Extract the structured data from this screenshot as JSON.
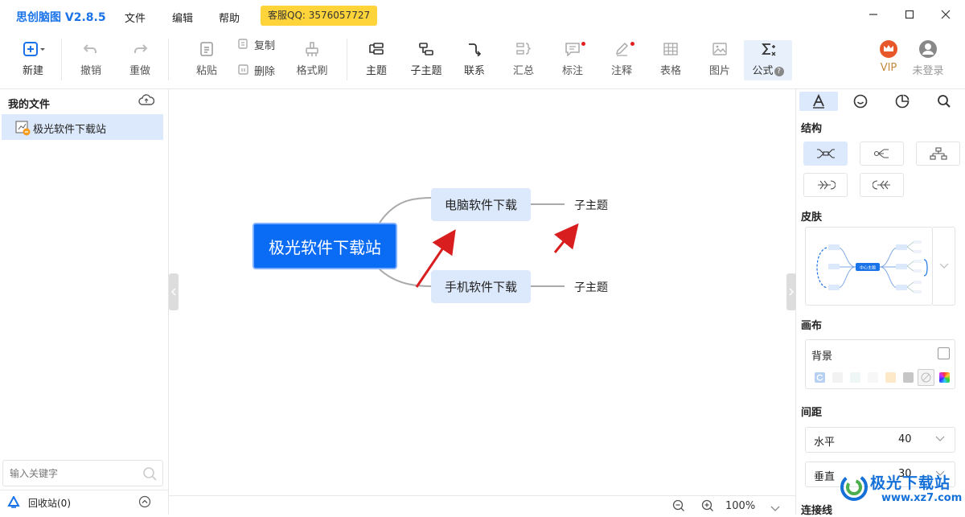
{
  "titlebar": {
    "app_title": "思创脑图 V2.8.5",
    "menus": [
      "文件",
      "编辑",
      "帮助"
    ],
    "qq_badge": "客服QQ: 3576057727"
  },
  "toolbar": {
    "new_label": "新建",
    "undo_label": "撤销",
    "redo_label": "重做",
    "paste_label": "粘贴",
    "copy_label": "复制",
    "delete_label": "删除",
    "format_brush_label": "格式刷",
    "topic_label": "主题",
    "subtopic_label": "子主题",
    "relation_label": "联系",
    "summary_label": "汇总",
    "marker_label": "标注",
    "note_label": "注释",
    "table_label": "表格",
    "image_label": "图片",
    "formula_label": "公式",
    "vip_label": "VIP",
    "login_label": "未登录"
  },
  "left_panel": {
    "title": "我的文件",
    "files": [
      "极光软件下载站"
    ],
    "search_placeholder": "输入关键字",
    "trash_label": "回收站(0)"
  },
  "mindmap": {
    "root": "极光软件下载站",
    "branches": [
      {
        "label": "电脑软件下载",
        "child": "子主题"
      },
      {
        "label": "手机软件下载",
        "child": "子主题"
      }
    ]
  },
  "statusbar": {
    "zoom": "100%"
  },
  "right_panel": {
    "structure_title": "结构",
    "skin_title": "皮肤",
    "canvas_title": "画布",
    "background_label": "背景",
    "spacing_title": "间距",
    "horizontal_label": "水平",
    "horizontal_value": "40",
    "vertical_label": "垂直",
    "vertical_value": "30",
    "connector_title": "连接线",
    "swatches": [
      "#cfe0f7",
      "#f2f2f2",
      "#eef6f6",
      "#f7f7f7",
      "#fde8c8",
      "#c6c6c6",
      "none",
      "rainbow"
    ]
  },
  "watermark": {
    "text": "极光下载站",
    "url": "www.xz7.com"
  },
  "colors": {
    "accent": "#1a73e8",
    "root_node": "#0a6cf5",
    "sub_node": "#dce8fb",
    "arrow": "#d81e1e"
  }
}
